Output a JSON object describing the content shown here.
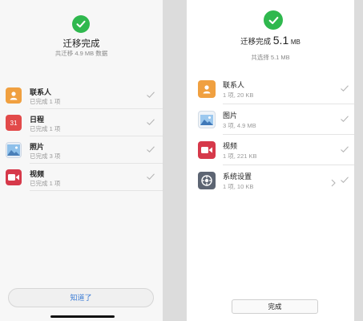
{
  "left": {
    "title": "迁移完成",
    "subtitle": "共迁移 4.9 MB 数据",
    "items": [
      {
        "label": "联系人",
        "status": "已完成 1 项",
        "icon": "contacts-icon"
      },
      {
        "label": "日程",
        "status": "已完成 1 项",
        "icon": "calendar-icon",
        "icon_text": "31"
      },
      {
        "label": "照片",
        "status": "已完成 3 项",
        "icon": "photos-icon"
      },
      {
        "label": "视频",
        "status": "已完成 1 项",
        "icon": "video-icon"
      }
    ],
    "button_label": "知道了"
  },
  "right": {
    "title_prefix": "迁移完成",
    "size_value": "5.1",
    "size_unit": "MB",
    "subtitle": "共选择 5.1 MB",
    "items": [
      {
        "label": "联系人",
        "status": "1 项, 20 KB",
        "icon": "contacts-icon"
      },
      {
        "label": "图片",
        "status": "3 项, 4.9 MB",
        "icon": "gallery-icon"
      },
      {
        "label": "视频",
        "status": "1 项, 221 KB",
        "icon": "video-icon"
      },
      {
        "label": "系统设置",
        "status": "1 项, 10 KB",
        "icon": "settings-icon"
      }
    ],
    "button_label": "完成"
  },
  "colors": {
    "success_green": "#2fb84e",
    "contacts_orange": "#f0a040",
    "calendar_red": "#e24a4a",
    "video_red": "#d6394a",
    "link_blue": "#3a7bd5"
  }
}
